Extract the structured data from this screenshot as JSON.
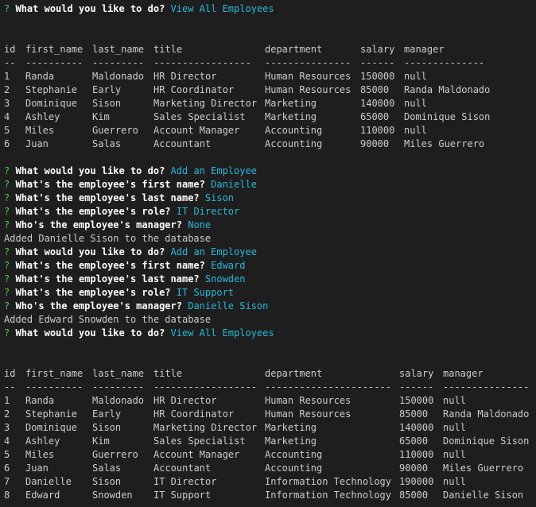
{
  "prompt_symbol": "?",
  "lines": [
    {
      "type": "prompt",
      "question": "What would you like to do?",
      "answer": "View All Employees"
    },
    {
      "type": "blank"
    },
    {
      "type": "blank"
    },
    {
      "type": "table_header",
      "table": 0
    },
    {
      "type": "table_sep",
      "table": 0
    },
    {
      "type": "table_row",
      "table": 0,
      "row": 0
    },
    {
      "type": "table_row",
      "table": 0,
      "row": 1
    },
    {
      "type": "table_row",
      "table": 0,
      "row": 2
    },
    {
      "type": "table_row",
      "table": 0,
      "row": 3
    },
    {
      "type": "table_row",
      "table": 0,
      "row": 4
    },
    {
      "type": "table_row",
      "table": 0,
      "row": 5
    },
    {
      "type": "blank"
    },
    {
      "type": "prompt",
      "question": "What would you like to do?",
      "answer": "Add an Employee"
    },
    {
      "type": "prompt",
      "question": "What's the employee's first name?",
      "answer": "Danielle"
    },
    {
      "type": "prompt",
      "question": "What's the employee's last name?",
      "answer": "Sison"
    },
    {
      "type": "prompt",
      "question": "What's the employee's role?",
      "answer": "IT Director"
    },
    {
      "type": "prompt",
      "question": "Who's the employee's manager?",
      "answer": "None"
    },
    {
      "type": "text",
      "text": "Added Danielle Sison to the database"
    },
    {
      "type": "prompt",
      "question": "What would you like to do?",
      "answer": "Add an Employee"
    },
    {
      "type": "prompt",
      "question": "What's the employee's first name?",
      "answer": "Edward"
    },
    {
      "type": "prompt",
      "question": "What's the employee's last name?",
      "answer": "Snowden"
    },
    {
      "type": "prompt",
      "question": "What's the employee's role?",
      "answer": "IT Support"
    },
    {
      "type": "prompt",
      "question": "Who's the employee's manager?",
      "answer": "Danielle Sison"
    },
    {
      "type": "text",
      "text": "Added Edward Snowden to the database"
    },
    {
      "type": "prompt",
      "question": "What would you like to do?",
      "answer": "View All Employees"
    },
    {
      "type": "blank"
    },
    {
      "type": "blank"
    },
    {
      "type": "table_header",
      "table": 1
    },
    {
      "type": "table_sep",
      "table": 1
    },
    {
      "type": "table_row",
      "table": 1,
      "row": 0
    },
    {
      "type": "table_row",
      "table": 1,
      "row": 1
    },
    {
      "type": "table_row",
      "table": 1,
      "row": 2
    },
    {
      "type": "table_row",
      "table": 1,
      "row": 3
    },
    {
      "type": "table_row",
      "table": 1,
      "row": 4
    },
    {
      "type": "table_row",
      "table": 1,
      "row": 5
    },
    {
      "type": "table_row",
      "table": 1,
      "row": 6
    },
    {
      "type": "table_row",
      "table": 1,
      "row": 7
    }
  ],
  "tables": [
    {
      "columns": [
        "id",
        "first_name",
        "last_name",
        "title",
        "department",
        "salary",
        "manager"
      ],
      "separators": [
        "--",
        "----------",
        "---------",
        "-----------------",
        "---------------",
        "------",
        "--------------"
      ],
      "rows": [
        [
          "1",
          "Randa",
          "Maldonado",
          "HR Director",
          "Human Resources",
          "150000",
          "null"
        ],
        [
          "2",
          "Stephanie",
          "Early",
          "HR Coordinator",
          "Human Resources",
          "85000",
          "Randa Maldonado"
        ],
        [
          "3",
          "Dominique",
          "Sison",
          "Marketing Director",
          "Marketing",
          "140000",
          "null"
        ],
        [
          "4",
          "Ashley",
          "Kim",
          "Sales Specialist",
          "Marketing",
          "65000",
          "Dominique Sison"
        ],
        [
          "5",
          "Miles",
          "Guerrero",
          "Account Manager",
          "Accounting",
          "110000",
          "null"
        ],
        [
          "6",
          "Juan",
          "Salas",
          "Accountant",
          "Accounting",
          "90000",
          "Miles Guerrero"
        ]
      ]
    },
    {
      "columns": [
        "id",
        "first_name",
        "last_name",
        "title",
        "department",
        "salary",
        "manager"
      ],
      "separators": [
        "--",
        "----------",
        "---------",
        "------------------",
        "----------------------",
        "------",
        "---------------"
      ],
      "rows": [
        [
          "1",
          "Randa",
          "Maldonado",
          "HR Director",
          "Human Resources",
          "150000",
          "null"
        ],
        [
          "2",
          "Stephanie",
          "Early",
          "HR Coordinator",
          "Human Resources",
          "85000",
          "Randa Maldonado"
        ],
        [
          "3",
          "Dominique",
          "Sison",
          "Marketing Director",
          "Marketing",
          "140000",
          "null"
        ],
        [
          "4",
          "Ashley",
          "Kim",
          "Sales Specialist",
          "Marketing",
          "65000",
          "Dominique Sison"
        ],
        [
          "5",
          "Miles",
          "Guerrero",
          "Account Manager",
          "Accounting",
          "110000",
          "null"
        ],
        [
          "6",
          "Juan",
          "Salas",
          "Accountant",
          "Accounting",
          "90000",
          "Miles Guerrero"
        ],
        [
          "7",
          "Danielle",
          "Sison",
          "IT Director",
          "Information Technology",
          "190000",
          "null"
        ],
        [
          "8",
          "Edward",
          "Snowden",
          "IT Support",
          "Information Technology",
          "85000",
          "Danielle Sison"
        ]
      ]
    }
  ],
  "colors": {
    "background": "#1e1e1e",
    "prompt_mark": "#4ec94e",
    "question": "#ffffff",
    "answer": "#29b8db",
    "text": "#cccccc"
  }
}
